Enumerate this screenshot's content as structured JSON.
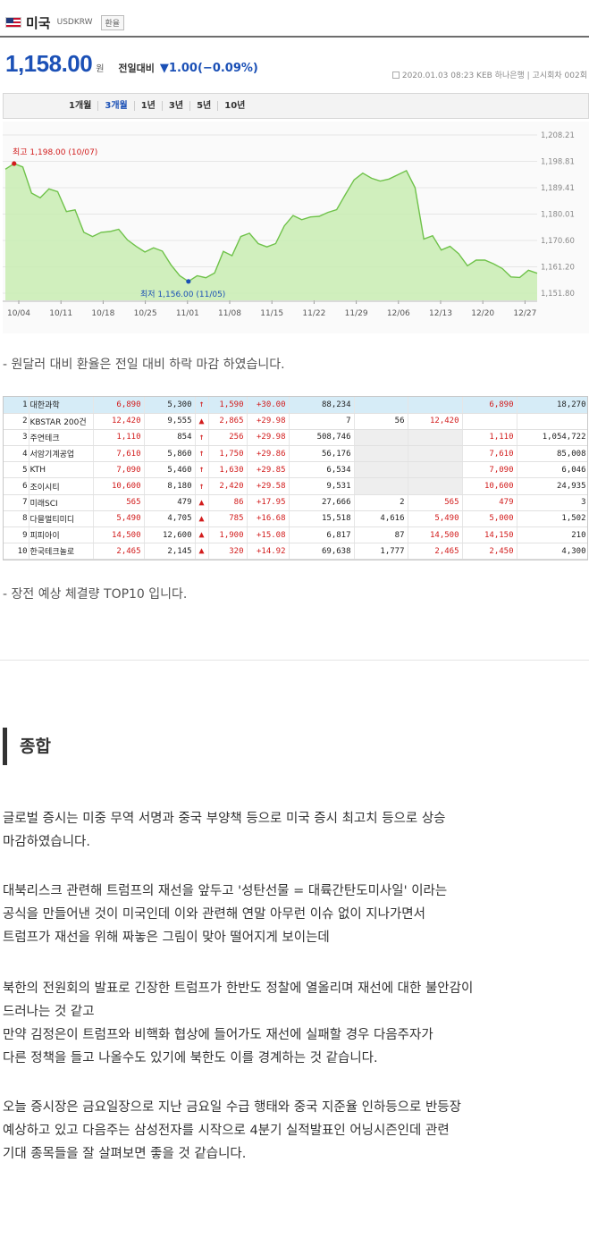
{
  "fx": {
    "country": "미국",
    "symbol": "USDKRW",
    "tag": "환율",
    "price": "1,158.00",
    "unit": "원",
    "change_label": "전일대비",
    "change": "▼1.00(−0.09%)",
    "meta": "2020.01.03 08:23  KEB 하나은행 | 고시회차 002회",
    "periods": [
      "1개월",
      "3개월",
      "1년",
      "3년",
      "5년",
      "10년"
    ],
    "active_period": "3개월"
  },
  "chart_data": {
    "type": "area",
    "x_ticks": [
      "10/04",
      "10/11",
      "10/18",
      "10/25",
      "11/01",
      "11/08",
      "11/15",
      "11/22",
      "11/29",
      "12/06",
      "12/13",
      "12/20",
      "12/27"
    ],
    "y_ticks": [
      "1,208.21",
      "1,198.81",
      "1,189.41",
      "1,180.01",
      "1,170.60",
      "1,161.20",
      "1,151.80"
    ],
    "ylim": [
      1151.8,
      1208.21
    ],
    "high_label": "최고 1,198.00 (10/07)",
    "low_label": "최저 1,156.00 (11/05)",
    "colors": {
      "line": "#6fc24a",
      "fill": "#c8ecb2",
      "high": "#d21c1c",
      "low": "#1b50b6"
    },
    "values": [
      1196.0,
      1198.0,
      1196.8,
      1187.5,
      1185.8,
      1189.0,
      1188.0,
      1180.9,
      1181.5,
      1173.5,
      1172.0,
      1173.5,
      1173.8,
      1174.6,
      1170.8,
      1168.5,
      1166.5,
      1168.0,
      1166.8,
      1161.9,
      1158.0,
      1156.0,
      1158.0,
      1157.3,
      1159.0,
      1166.7,
      1165.2,
      1172.0,
      1173.2,
      1169.5,
      1168.3,
      1169.5,
      1175.8,
      1179.5,
      1178.0,
      1179.0,
      1179.2,
      1180.6,
      1181.6,
      1187.0,
      1192.2,
      1194.6,
      1192.8,
      1191.8,
      1192.5,
      1194.0,
      1195.5,
      1189.4,
      1171.1,
      1172.3,
      1167.2,
      1168.5,
      1165.9,
      1161.6,
      1163.6,
      1163.6,
      1162.3,
      1160.6,
      1157.6,
      1157.4,
      1160.0,
      1158.9
    ]
  },
  "caption1": "- 원달러 대비 환율은 전일 대비 하락 마감 하였습니다.",
  "table": {
    "rows": [
      [
        "1",
        "대한과학",
        "6,890",
        "5,300",
        "↑",
        "1,590",
        "+30.00",
        "88,234",
        "",
        "",
        "6,890",
        "18,270"
      ],
      [
        "2",
        "KBSTAR 200건",
        "12,420",
        "9,555",
        "▲",
        "2,865",
        "+29.98",
        "7",
        "56",
        "12,420",
        "",
        ""
      ],
      [
        "3",
        "주연테크",
        "1,110",
        "854",
        "↑",
        "256",
        "+29.98",
        "508,746",
        "",
        "",
        "1,110",
        "1,054,722"
      ],
      [
        "4",
        "서암기계공업",
        "7,610",
        "5,860",
        "↑",
        "1,750",
        "+29.86",
        "56,176",
        "",
        "",
        "7,610",
        "85,008"
      ],
      [
        "5",
        "KTH",
        "7,090",
        "5,460",
        "↑",
        "1,630",
        "+29.85",
        "6,534",
        "",
        "",
        "7,090",
        "6,046"
      ],
      [
        "6",
        "조이시티",
        "10,600",
        "8,180",
        "↑",
        "2,420",
        "+29.58",
        "9,531",
        "",
        "",
        "10,600",
        "24,935"
      ],
      [
        "7",
        "미래SCI",
        "565",
        "479",
        "▲",
        "86",
        "+17.95",
        "27,666",
        "2",
        "565",
        "479",
        "3"
      ],
      [
        "8",
        "다믈멀티미디",
        "5,490",
        "4,705",
        "▲",
        "785",
        "+16.68",
        "15,518",
        "4,616",
        "5,490",
        "5,000",
        "1,502"
      ],
      [
        "9",
        "피피아이",
        "14,500",
        "12,600",
        "▲",
        "1,900",
        "+15.08",
        "6,817",
        "87",
        "14,500",
        "14,150",
        "210"
      ],
      [
        "10",
        "한국테크놀로",
        "2,465",
        "2,145",
        "▲",
        "320",
        "+14.92",
        "69,638",
        "1,777",
        "2,465",
        "2,450",
        "4,300"
      ]
    ]
  },
  "caption2": "- 장전 예상 체결량 TOP10 입니다.",
  "section_title": "종합",
  "paragraphs": [
    [
      "글로벌 증시는 미중 무역 서명과 중국 부양책 등으로 미국 증시 최고치 등으로 상승",
      "마감하였습니다."
    ],
    [
      "대북리스크 관련해 트럼프의 재선을 앞두고 '성탄선물 = 대륙간탄도미사일' 이라는",
      "공식을 만들어낸 것이 미국인데 이와 관련해 연말 아무런 이슈 없이 지나가면서",
      " 트럼프가 재선을 위해 짜놓은 그림이 맞아 떨어지게 보이는데"
    ],
    [
      "북한의 전원회의 발표로 긴장한 트럼프가 한반도 정찰에 열올리며 재선에 대한 불안감이",
      "드러나는 것 같고",
      "만약 김정은이 트럼프와 비핵화 협상에 들어가도 재선에 실패할 경우 다음주자가",
      "다른 정책을 들고 나올수도 있기에 북한도 이를 경계하는 것 같습니다."
    ],
    [
      "오늘 증시장은 금요일장으로 지난 금요일 수급 행태와 중국 지준율 인하등으로 반등장",
      "예상하고 있고 다음주는 삼성전자를 시작으로 4분기 실적발표인 어닝시즌인데 관련",
      "기대 종목들을 잘 살펴보면 좋을 것 같습니다."
    ]
  ]
}
